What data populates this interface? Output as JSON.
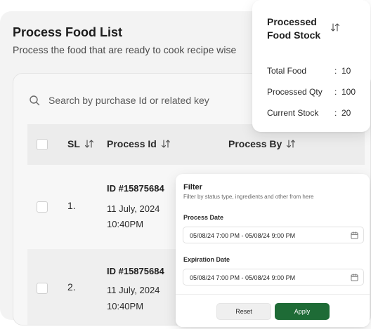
{
  "page": {
    "title": "Process Food List",
    "subtitle": "Process the food that are ready to cook recipe wise"
  },
  "search": {
    "placeholder": "Search by purchase Id or related key"
  },
  "table": {
    "headers": {
      "sl": "SL",
      "process_id": "Process Id",
      "process_by": "Process By"
    },
    "rows": [
      {
        "sl": "1.",
        "id": "ID #15875684",
        "date": "11 July, 2024",
        "time": "10:40PM"
      },
      {
        "sl": "2.",
        "id": "ID #15875684",
        "date": "11 July, 2024",
        "time": "10:40PM"
      }
    ]
  },
  "stock": {
    "title_line1": "Processed",
    "title_line2": "Food Stock",
    "stats": [
      {
        "label": "Total Food",
        "colon": ":",
        "value": "10"
      },
      {
        "label": "Processed Qty",
        "colon": ":",
        "value": "100"
      },
      {
        "label": "Current Stock",
        "colon": ":",
        "value": "20"
      }
    ]
  },
  "filter": {
    "title": "Filter",
    "subtitle": "Filter by status type, ingredients and other from here",
    "process_date_label": "Process Date",
    "process_date_value": "05/08/24 7:00 PM - 05/08/24 9:00 PM",
    "expiration_date_label": "Expiration Date",
    "expiration_date_value": "05/08/24 7:00 PM - 05/08/24 9:00 PM",
    "reset_label": "Reset",
    "apply_label": "Apply"
  },
  "colors": {
    "accent": "#1e6b36",
    "card_bg": "#f3f3f3",
    "header_bg": "#ececec"
  },
  "icons": {
    "search": "search-icon",
    "sort": "sort-icon",
    "calendar": "calendar-icon"
  }
}
